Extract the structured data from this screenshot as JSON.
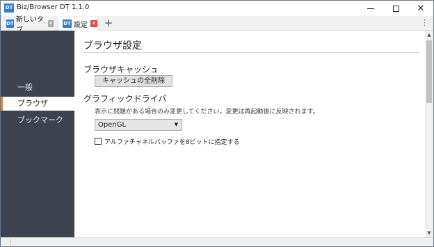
{
  "window": {
    "logo_text": "DT",
    "title": "Biz/Browser DT 1.1.0",
    "minimize_icon": "minimize-icon",
    "maximize_icon": "maximize-icon",
    "close_glyph": "✕"
  },
  "tabs": [
    {
      "logo_text": "DT",
      "label": "新しいタブ",
      "close_glyph": "✕",
      "active": false
    },
    {
      "logo_text": "DT",
      "label": "設定",
      "close_glyph": "✕",
      "active": true
    }
  ],
  "tabbar": {
    "new_tab_glyph": "+",
    "menu_glyph": "⋮"
  },
  "sidebar": {
    "items": [
      {
        "label": "一般",
        "active": false
      },
      {
        "label": "ブラウザ",
        "active": true
      },
      {
        "label": "ブックマーク",
        "active": false
      }
    ],
    "accent_color": "#ef7d22",
    "background_color": "#3e4350"
  },
  "main": {
    "page_title": "ブラウザ設定",
    "cache": {
      "heading": "ブラウザキャッシュ",
      "clear_button": "キャッシュの全削除"
    },
    "gpu": {
      "heading": "グラフィックドライバ",
      "note": "表示に問題がある場合のみ変更してください。変更は再起動後に反映されます。",
      "selected": "OpenGL",
      "dropdown_glyph": "▼"
    },
    "alpha_buffer": {
      "label": "アルファチャネルバッファを8ビットに指定する",
      "checked": false
    }
  },
  "scrollbar": {
    "up_glyph": "▲",
    "down_glyph": "▼"
  }
}
